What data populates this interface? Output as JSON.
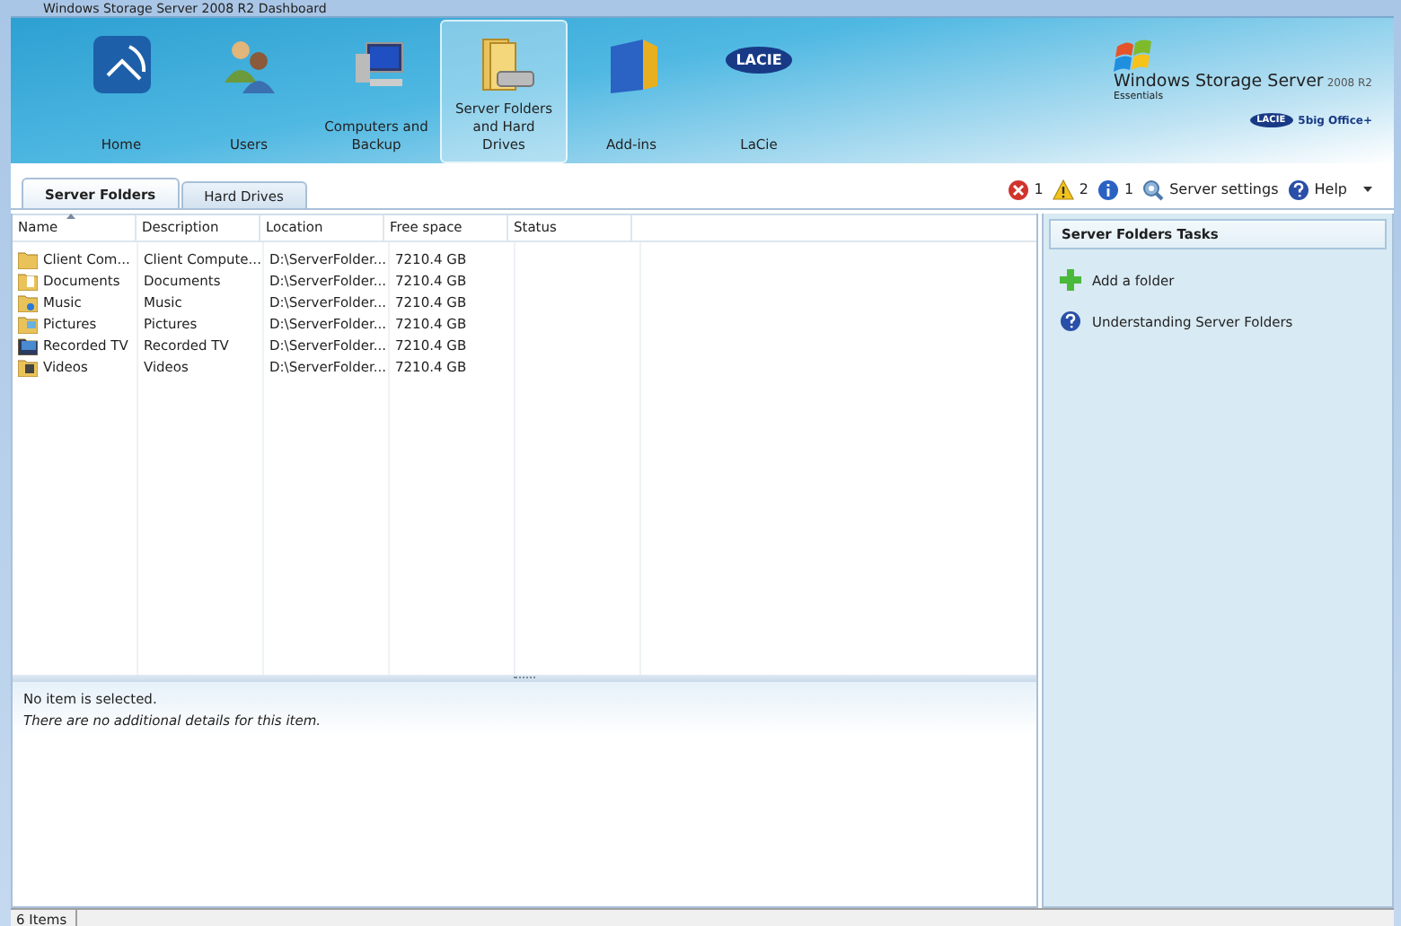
{
  "window": {
    "title": "Windows Storage Server 2008 R2 Dashboard"
  },
  "nav": [
    {
      "kind": "home",
      "label": "Home",
      "selected": false
    },
    {
      "kind": "users",
      "label": "Users",
      "selected": false
    },
    {
      "kind": "computers",
      "label": "Computers and Backup",
      "selected": false
    },
    {
      "kind": "folders",
      "label": "Server Folders and Hard Drives",
      "selected": true
    },
    {
      "kind": "addins",
      "label": "Add-ins",
      "selected": false
    },
    {
      "kind": "lacie",
      "label": "LaCie",
      "logo_text": "LACIE",
      "selected": false
    }
  ],
  "brand": {
    "product": "Windows Storage Server",
    "version": "2008 R2",
    "edition": "Essentials",
    "device_logo": "LACIE",
    "device": "5big Office+"
  },
  "tabs": [
    {
      "label": "Server Folders",
      "selected": true
    },
    {
      "label": "Hard Drives",
      "selected": false
    }
  ],
  "alerts": [
    {
      "kind": "error",
      "count": "1"
    },
    {
      "kind": "warning",
      "count": "2"
    },
    {
      "kind": "info",
      "count": "1"
    }
  ],
  "toolbar": [
    {
      "kind": "settings",
      "label": "Server settings"
    },
    {
      "kind": "help",
      "label": "Help",
      "dropdown": true
    }
  ],
  "table": {
    "columns": [
      {
        "label": "Name",
        "sorted": true
      },
      {
        "label": "Description",
        "sorted": false
      },
      {
        "label": "Location",
        "sorted": false
      },
      {
        "label": "Free space",
        "sorted": false
      },
      {
        "label": "Status",
        "sorted": false
      }
    ],
    "rows": [
      {
        "kind": "folder",
        "name": "Client Com...",
        "description": "Client Compute...",
        "location": "D:\\ServerFolder...",
        "free_space": "7210.4 GB"
      },
      {
        "kind": "documents",
        "name": "Documents",
        "description": "Documents",
        "location": "D:\\ServerFolder...",
        "free_space": "7210.4 GB"
      },
      {
        "kind": "music",
        "name": "Music",
        "description": "Music",
        "location": "D:\\ServerFolder...",
        "free_space": "7210.4 GB"
      },
      {
        "kind": "pictures",
        "name": "Pictures",
        "description": "Pictures",
        "location": "D:\\ServerFolder...",
        "free_space": "7210.4 GB"
      },
      {
        "kind": "tv",
        "name": "Recorded TV",
        "description": "Recorded TV",
        "location": "D:\\ServerFolder...",
        "free_space": "7210.4 GB"
      },
      {
        "kind": "videos",
        "name": "Videos",
        "description": "Videos",
        "location": "D:\\ServerFolder...",
        "free_space": "7210.4 GB"
      }
    ]
  },
  "details": {
    "selection": "No item is selected.",
    "note": "There are no additional details for this item."
  },
  "tasks": {
    "title": "Server Folders Tasks",
    "items": [
      {
        "kind": "add",
        "label": "Add a folder"
      },
      {
        "kind": "help",
        "label": "Understanding Server Folders"
      }
    ]
  },
  "status_bar": {
    "count": "6 Items"
  }
}
